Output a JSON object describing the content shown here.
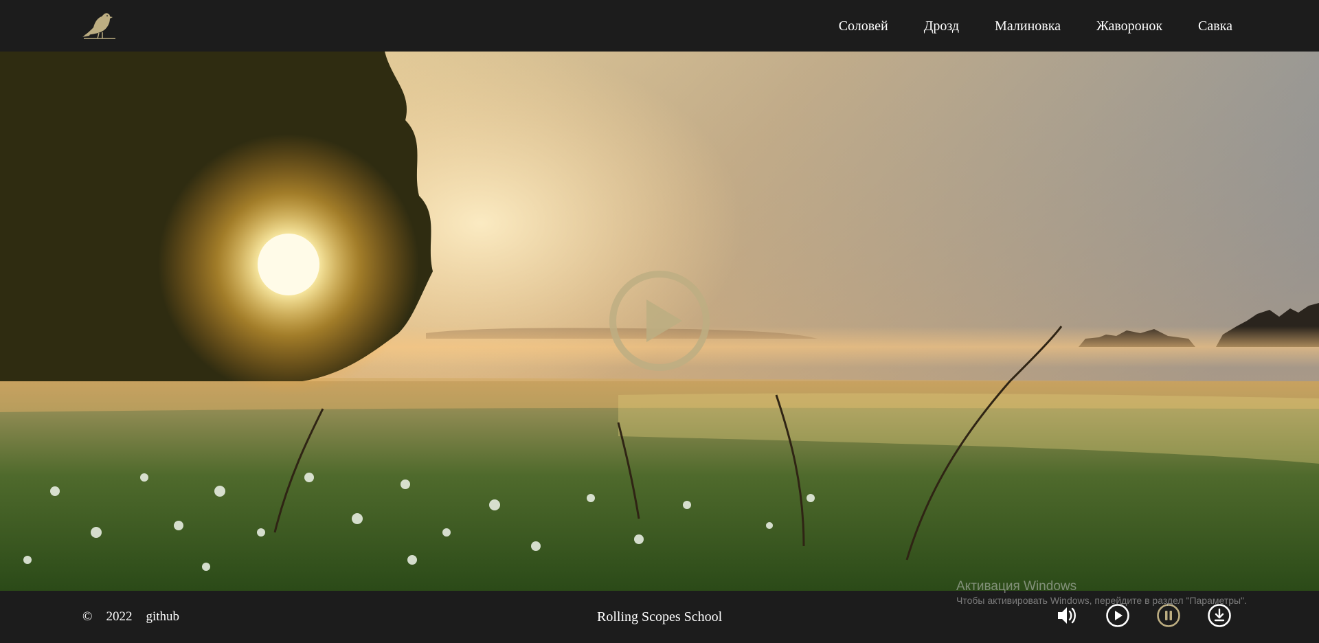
{
  "header": {
    "logo_icon": "bird-icon",
    "nav": [
      {
        "label": "Соловей"
      },
      {
        "label": "Дрозд"
      },
      {
        "label": "Малиновка"
      },
      {
        "label": "Жаворонок"
      },
      {
        "label": "Савка"
      }
    ]
  },
  "main": {
    "background": "sunrise-meadow-photo",
    "play_icon": "play-circle-icon"
  },
  "footer": {
    "copyright_symbol": "©",
    "year": "2022",
    "github": "github",
    "school": "Rolling Scopes School",
    "controls": [
      {
        "icon": "volume-icon"
      },
      {
        "icon": "play-icon"
      },
      {
        "icon": "pause-icon",
        "active": true
      },
      {
        "icon": "download-icon"
      }
    ]
  },
  "watermark": {
    "title": "Активация Windows",
    "subtitle": "Чтобы активировать Windows, перейдите в раздел \"Параметры\"."
  },
  "colors": {
    "background": "#1c1c1c",
    "accent": "#bdae82",
    "text": "#ffffff"
  }
}
